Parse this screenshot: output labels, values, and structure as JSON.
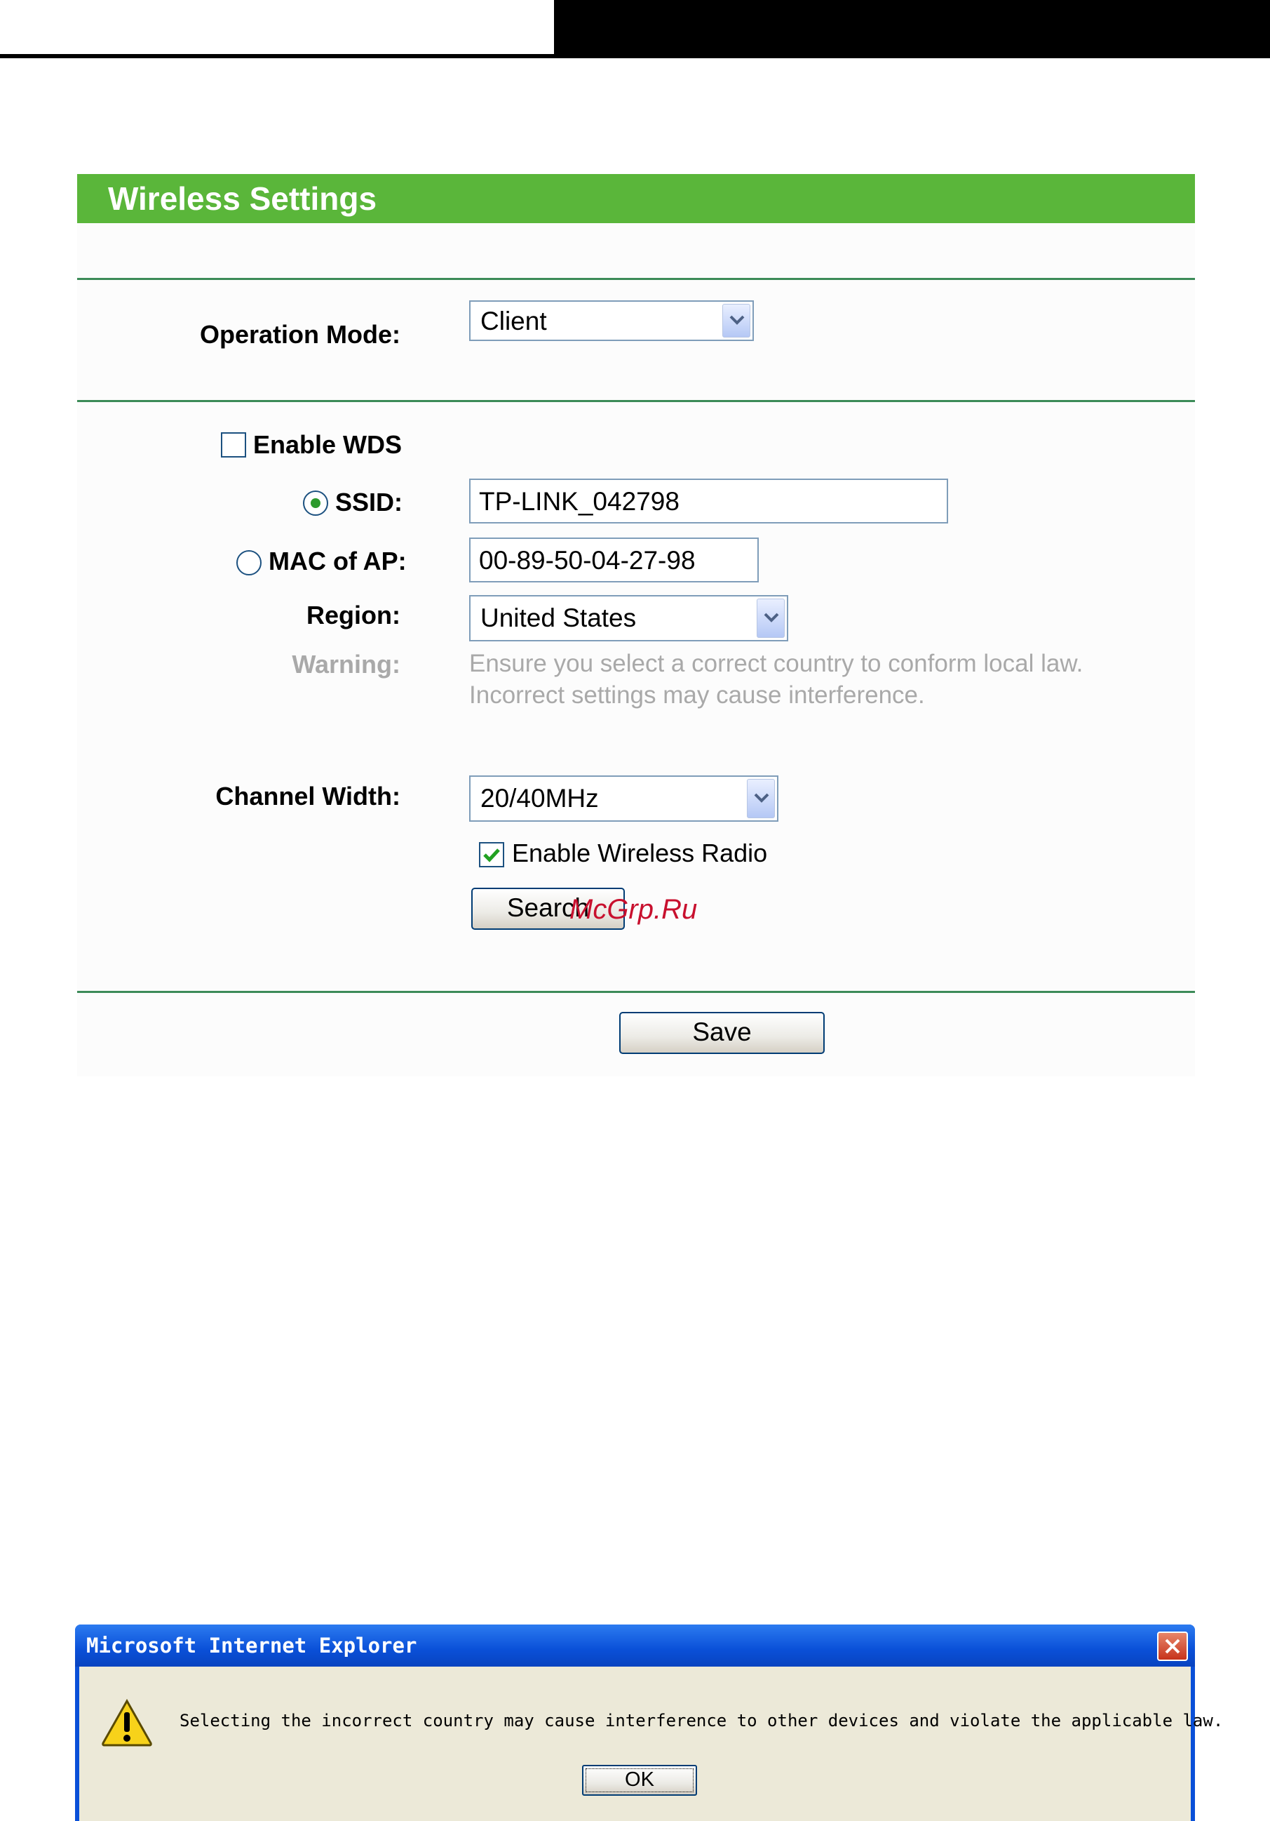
{
  "panel": {
    "title": "Wireless Settings",
    "operation_mode": {
      "label": "Operation Mode:",
      "value": "Client"
    },
    "enable_wds": {
      "label": "Enable WDS",
      "checked": false
    },
    "ssid": {
      "label": "SSID:",
      "value": "TP-LINK_042798",
      "selected": true
    },
    "mac_of_ap": {
      "label": "MAC of AP:",
      "value": "00-89-50-04-27-98",
      "selected": false
    },
    "region": {
      "label": "Region:",
      "value": "United States"
    },
    "warning": {
      "label": "Warning:",
      "line1": "Ensure you select a correct country to conform local law.",
      "line2": "Incorrect settings may cause interference."
    },
    "channel_width": {
      "label": "Channel Width:",
      "value": "20/40MHz"
    },
    "enable_wireless_radio": {
      "label": "Enable Wireless Radio",
      "checked": true
    },
    "search_button": "Search",
    "save_button": "Save"
  },
  "watermark": "McGrp.Ru",
  "dialog": {
    "title": "Microsoft Internet Explorer",
    "message": "Selecting the incorrect country may cause interference to other devices and violate the applicable law.",
    "ok_button": "OK",
    "icon": "warning-icon"
  },
  "colors": {
    "title_bar": "#5ab63a",
    "separator": "#3c8b58",
    "warning_text": "#a9a9a9",
    "dialog_frame": "#0a50d8"
  }
}
